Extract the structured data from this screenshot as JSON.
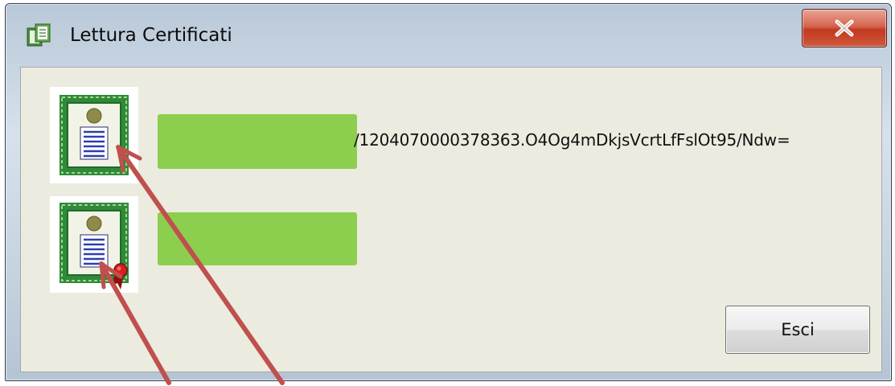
{
  "window": {
    "title": "Lettura Certificati",
    "title_icon": "certificate-window-icon",
    "close_label": "x"
  },
  "certificates": [
    {
      "icon": "certificate-icon",
      "text": "/1204070000378363.O4Og4mDkjsVcrtLfFslOt95/Ndw=",
      "redacted": true
    },
    {
      "icon": "certificate-with-ribbon-icon",
      "text": "",
      "redacted": true
    }
  ],
  "buttons": {
    "exit_label": "Esci"
  },
  "colors": {
    "dialog_bg": "#ecebdf",
    "redaction": "#8ccf4e",
    "annotation_arrow": "#c0504d",
    "close_button": "#c2391f"
  }
}
